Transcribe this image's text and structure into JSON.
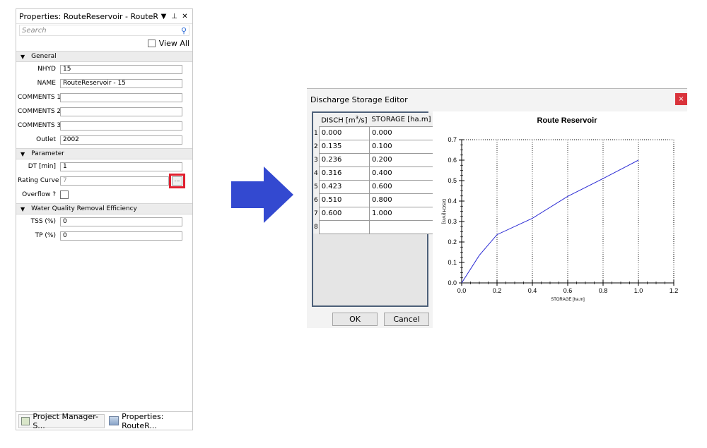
{
  "props": {
    "title": "Properties: RouteReservoir - RouteReserv...",
    "search_placeholder": "Search",
    "view_all": "View All",
    "sections": {
      "general": "General",
      "parameter": "Parameter",
      "wq": "Water Quality Removal Efficiency"
    },
    "fields": {
      "nhyd": {
        "label": "NHYD",
        "value": "15"
      },
      "name": {
        "label": "NAME",
        "value": "RouteReservoir - 15"
      },
      "comments1": {
        "label": "COMMENTS 1",
        "value": ""
      },
      "comments2": {
        "label": "COMMENTS 2",
        "value": ""
      },
      "comments3": {
        "label": "COMMENTS 3",
        "value": ""
      },
      "outlet": {
        "label": "Outlet",
        "value": "2002"
      },
      "dt": {
        "label": "DT [min]",
        "value": "1"
      },
      "rating": {
        "label": "Rating Curve",
        "value": "7",
        "button": "..."
      },
      "overflow": {
        "label": "Overflow ?"
      },
      "tss": {
        "label": "TSS (%)",
        "value": "0"
      },
      "tp": {
        "label": "TP (%)",
        "value": "0"
      }
    },
    "tabs": {
      "project": "Project Manager- S...",
      "properties": "Properties: RouteR..."
    }
  },
  "dialog": {
    "title": "Discharge Storage Editor",
    "close": "×",
    "col1_text": "DISCH [m",
    "col1_sup": "3",
    "col1_tail": "/s]",
    "col2": "STORAGE [ha.m]",
    "rows": [
      {
        "n": "1",
        "disch": "0.000",
        "storage": "0.000"
      },
      {
        "n": "2",
        "disch": "0.135",
        "storage": "0.100"
      },
      {
        "n": "3",
        "disch": "0.236",
        "storage": "0.200"
      },
      {
        "n": "4",
        "disch": "0.316",
        "storage": "0.400"
      },
      {
        "n": "5",
        "disch": "0.423",
        "storage": "0.600"
      },
      {
        "n": "6",
        "disch": "0.510",
        "storage": "0.800"
      },
      {
        "n": "7",
        "disch": "0.600",
        "storage": "1.000"
      },
      {
        "n": "8",
        "disch": "",
        "storage": ""
      }
    ],
    "ok": "OK",
    "cancel": "Cancel"
  },
  "chart_data": {
    "type": "line",
    "title": "Route Reservoir",
    "xlabel": "STORAGE [ha.m]",
    "ylabel": "DISCH [m³/s]",
    "x": [
      0.0,
      0.1,
      0.2,
      0.4,
      0.6,
      0.8,
      1.0
    ],
    "series": [
      {
        "values": [
          0.0,
          0.135,
          0.236,
          0.316,
          0.423,
          0.51,
          0.6
        ]
      }
    ],
    "xlim": [
      0,
      1.2
    ],
    "ylim": [
      0,
      0.7
    ],
    "xticks": [
      "0.0",
      "0.2",
      "0.4",
      "0.6",
      "0.8",
      "1.0",
      "1.2"
    ],
    "yticks": [
      "0.0",
      "0.1",
      "0.2",
      "0.3",
      "0.4",
      "0.5",
      "0.6",
      "0.7"
    ],
    "line_color": "#2929d4",
    "grid": "vertical dotted"
  },
  "colors": {
    "arrow": "#3349d0",
    "highlight": "#e0202f",
    "close_button": "#d9333b"
  }
}
